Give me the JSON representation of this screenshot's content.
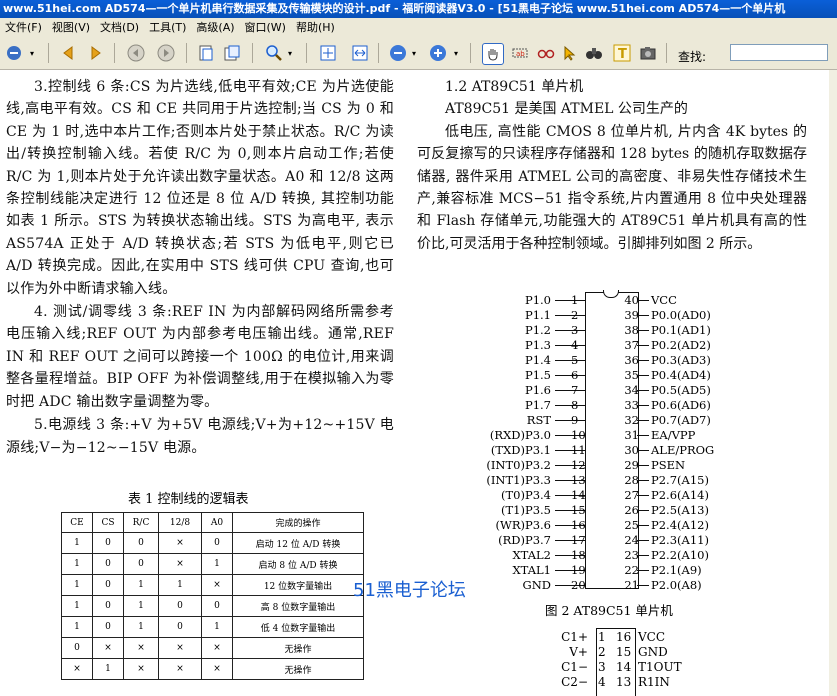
{
  "window": {
    "title": "www.51hei.com AD574—一个单片机串行数据采集及传输模块的设计.pdf - 福昕阅读器V3.0 - [51黑电子论坛 www.51hei.com AD574—一个单片机"
  },
  "menu": [
    "文件(F)",
    "视图(V)",
    "文档(D)",
    "工具(T)",
    "高级(A)",
    "窗口(W)",
    "帮助(H)"
  ],
  "toolbar": {
    "find_label": "查找:",
    "find_value": ""
  },
  "icons": {
    "back": "arrow-left-icon",
    "forward": "arrow-right-icon",
    "prev": "circle-left-icon",
    "next": "circle-right-icon",
    "zoom": "zoom-icon",
    "fit": "fit-page-icon",
    "hand": "hand-icon",
    "select": "select-text-icon",
    "snapshot": "camera-icon"
  },
  "left_column": [
    "3.控制线 6 条:CS 为片选线,低电平有效;CE 为片选使能线,高电平有效。CS 和 CE 共同用于片选控制;当 CS 为 0 和 CE 为 1 时,选中本片工作;否则本片处于禁止状态。R/C 为读出/转换控制输入线。若使 R/C 为 0,则本片启动工作;若使 R/C 为 1,则本片处于允许读出数字量状态。A0 和 12/8 这两条控制线能决定进行 12 位还是 8 位 A/D 转换, 其控制功能如表 1 所示。STS 为转换状态输出线。STS 为高电平, 表示AS574A 正处于 A/D 转换状态;若 STS 为低电平,则它已 A/D 转换完成。因此,在实用中 STS 线可供 CPU 查询,也可以作为外中断请求输入线。",
    "4. 测试/调零线 3 条:REF IN 为内部解码网络所需参考电压输入线;REF OUT 为内部参考电压输出线。通常,REF IN 和 REF OUT 之间可以跨接一个 100Ω 的电位计,用来调整各量程增益。BIP OFF 为补偿调整线,用于在模拟输入为零时把 ADC 输出数字量调整为零。",
    "5.电源线 3 条:+V 为+5V 电源线;V+为+12~+15V 电源线;V−为−12~−15V 电源。"
  ],
  "table": {
    "caption": "表 1  控制线的逻辑表",
    "headers": [
      "CE",
      "CS",
      "R/C",
      "12/8",
      "A0",
      "完成的操作"
    ],
    "rows": [
      [
        "1",
        "0",
        "0",
        "×",
        "0",
        "启动 12 位 A/D 转换"
      ],
      [
        "1",
        "0",
        "0",
        "×",
        "1",
        "启动 8 位 A/D 转换"
      ],
      [
        "1",
        "0",
        "1",
        "1",
        "×",
        "12 位数字量输出"
      ],
      [
        "1",
        "0",
        "1",
        "0",
        "0",
        "高 8 位数字量输出"
      ],
      [
        "1",
        "0",
        "1",
        "0",
        "1",
        "低 4 位数字量输出"
      ],
      [
        "0",
        "×",
        "×",
        "×",
        "×",
        "无操作"
      ],
      [
        "×",
        "1",
        "×",
        "×",
        "×",
        "无操作"
      ]
    ]
  },
  "right_column": {
    "heading": "1.2 AT89C51 单片机",
    "intro": "AT89C51 是美国 ATMEL 公司生产的",
    "body": "低电压, 高性能 CMOS 8 位单片机, 片内含 4K bytes 的可反复擦写的只读程序存储器和 128 bytes 的随机存取数据存储器, 器件采用 ATMEL 公司的高密度、非易失性存储技术生产,兼容标准 MCS−51 指令系统,片内置通用 8 位中央处理器和 Flash 存储单元,功能强大的 AT89C51 单片机具有高的性价比,可灵活用于各种控制领域。引脚排列如图 2 所示。"
  },
  "pins": {
    "left": [
      {
        "num": "1",
        "name": "P1.0"
      },
      {
        "num": "2",
        "name": "P1.1"
      },
      {
        "num": "3",
        "name": "P1.2"
      },
      {
        "num": "4",
        "name": "P1.3"
      },
      {
        "num": "5",
        "name": "P1.4"
      },
      {
        "num": "6",
        "name": "P1.5"
      },
      {
        "num": "7",
        "name": "P1.6"
      },
      {
        "num": "8",
        "name": "P1.7"
      },
      {
        "num": "9",
        "name": "RST"
      },
      {
        "num": "10",
        "name": "(RXD)P3.0"
      },
      {
        "num": "11",
        "name": "(TXD)P3.1"
      },
      {
        "num": "12",
        "name": "(INT0)P3.2"
      },
      {
        "num": "13",
        "name": "(INT1)P3.3"
      },
      {
        "num": "14",
        "name": "(T0)P3.4"
      },
      {
        "num": "15",
        "name": "(T1)P3.5"
      },
      {
        "num": "16",
        "name": "(WR)P3.6"
      },
      {
        "num": "17",
        "name": "(RD)P3.7"
      },
      {
        "num": "18",
        "name": "XTAL2"
      },
      {
        "num": "19",
        "name": "XTAL1"
      },
      {
        "num": "20",
        "name": "GND"
      }
    ],
    "right": [
      {
        "num": "40",
        "name": "VCC"
      },
      {
        "num": "39",
        "name": "P0.0(AD0)"
      },
      {
        "num": "38",
        "name": "P0.1(AD1)"
      },
      {
        "num": "37",
        "name": "P0.2(AD2)"
      },
      {
        "num": "36",
        "name": "P0.3(AD3)"
      },
      {
        "num": "35",
        "name": "P0.4(AD4)"
      },
      {
        "num": "34",
        "name": "P0.5(AD5)"
      },
      {
        "num": "33",
        "name": "P0.6(AD6)"
      },
      {
        "num": "32",
        "name": "P0.7(AD7)"
      },
      {
        "num": "31",
        "name": "EA/VPP"
      },
      {
        "num": "30",
        "name": "ALE/PROG"
      },
      {
        "num": "29",
        "name": "PSEN"
      },
      {
        "num": "28",
        "name": "P2.7(A15)"
      },
      {
        "num": "27",
        "name": "P2.6(A14)"
      },
      {
        "num": "26",
        "name": "P2.5(A13)"
      },
      {
        "num": "25",
        "name": "P2.4(A12)"
      },
      {
        "num": "24",
        "name": "P2.3(A11)"
      },
      {
        "num": "23",
        "name": "P2.2(A10)"
      },
      {
        "num": "22",
        "name": "P2.1(A9)"
      },
      {
        "num": "21",
        "name": "P2.0(A8)"
      }
    ]
  },
  "figure_caption": "图 2  AT89C51 单片机",
  "watermark": "51黑电子论坛",
  "chip2": {
    "left": [
      {
        "num": "1",
        "name": "C1+"
      },
      {
        "num": "2",
        "name": "V+"
      },
      {
        "num": "3",
        "name": "C1−"
      },
      {
        "num": "4",
        "name": "C2−"
      }
    ],
    "right": [
      {
        "num": "16",
        "name": "VCC"
      },
      {
        "num": "15",
        "name": "GND"
      },
      {
        "num": "14",
        "name": "T1OUT"
      },
      {
        "num": "13",
        "name": "R1IN"
      }
    ]
  }
}
